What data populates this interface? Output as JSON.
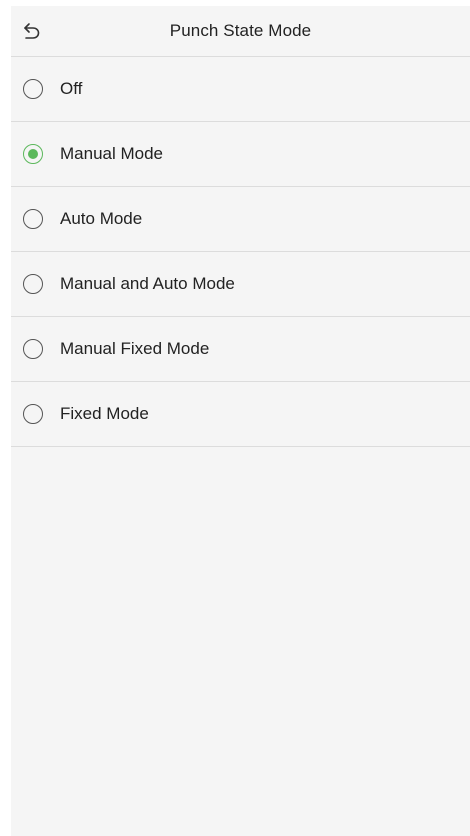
{
  "header": {
    "title": "Punch State Mode",
    "back_icon": "back-arrow-icon"
  },
  "options": [
    {
      "label": "Off",
      "selected": false
    },
    {
      "label": "Manual Mode",
      "selected": true
    },
    {
      "label": "Auto Mode",
      "selected": false
    },
    {
      "label": "Manual and Auto Mode",
      "selected": false
    },
    {
      "label": "Manual Fixed Mode",
      "selected": false
    },
    {
      "label": "Fixed Mode",
      "selected": false
    }
  ],
  "colors": {
    "accent": "#5cb85c",
    "background": "#f5f5f5",
    "divider": "#dcdcdc",
    "text": "#222222"
  }
}
